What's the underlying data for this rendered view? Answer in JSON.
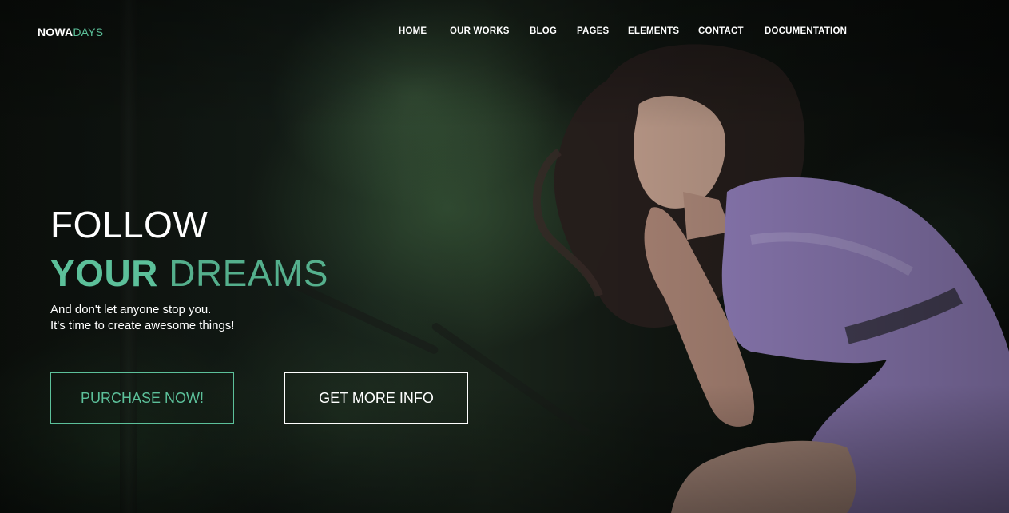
{
  "brand": {
    "name_main": "NOWA",
    "name_accent": "DAYS",
    "accent_color": "#5cc09a"
  },
  "nav": {
    "items": [
      {
        "label": "HOME"
      },
      {
        "label": "OUR WORKS"
      },
      {
        "label": "BLOG"
      },
      {
        "label": "PAGES"
      },
      {
        "label": "ELEMENTS"
      },
      {
        "label": "CONTACT"
      },
      {
        "label": "DOCUMENTATION"
      }
    ]
  },
  "hero": {
    "headline_line1": "FOLLOW",
    "headline_line2_strong": "YOUR",
    "headline_line2_light": "DREAMS",
    "subtitle_line1": "And don't let anyone stop you.",
    "subtitle_line2": "It's time to create awesome things!"
  },
  "buttons": {
    "purchase_label": "PURCHASE NOW!",
    "info_label": "GET MORE INFO"
  },
  "colors": {
    "accent": "#5cc09a",
    "dress": "#9b87c7",
    "text": "#ffffff"
  }
}
